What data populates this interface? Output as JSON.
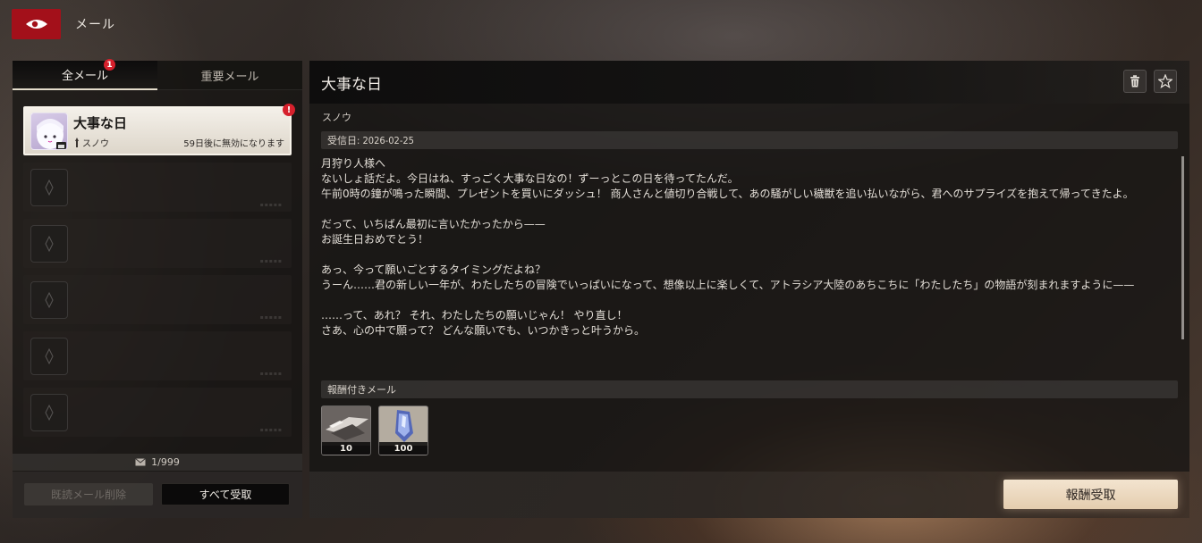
{
  "header": {
    "title": "メール",
    "back_icon": "back-eye-icon"
  },
  "tabs": [
    {
      "label": "全メール",
      "active": true,
      "badge": "1"
    },
    {
      "label": "重要メール",
      "active": false
    }
  ],
  "mail_list": {
    "selected": {
      "subject": "大事な日",
      "sender": "スノウ",
      "expiry": "59日後に無効になります",
      "alert": "!"
    },
    "empty_slots": 5
  },
  "mail_count": "1/999",
  "left_footer": {
    "delete_read_label": "既読メール削除",
    "receive_all_label": "すべて受取"
  },
  "detail": {
    "title": "大事な日",
    "sender": "スノウ",
    "received_date": "受信日: 2026-02-25",
    "body": "月狩り人様へ\nないしょ話だよ。今日はね、すっごく大事な日なの！ずーっとこの日を待ってたんだ。\n午前0時の鐘が鳴った瞬間、プレゼントを買いにダッシュ！ 商人さんと値切り合戦して、あの騒がしい穢獣を追い払いながら、君へのサプライズを抱えて帰ってきたよ。\n\nだって、いちばん最初に言いたかったから——\nお誕生日おめでとう！\n\nあっ、今って願いごとするタイミングだよね？\nうーん……君の新しい一年が、わたしたちの冒険でいっぱいになって、想像以上に楽しくて、アトラシア大陸のあちこちに「わたしたち」の物語が刻まれますように——\n\n……って、あれ？ それ、わたしたちの願いじゃん！ やり直し！\nさあ、心の中で願って？ どんな願いでも、いつかきっと叶うから。",
    "reward_section_label": "報酬付きメール",
    "rewards": [
      {
        "item": "weapon-material",
        "quantity": "10"
      },
      {
        "item": "crystal-shard",
        "quantity": "100"
      }
    ],
    "claim_label": "報酬受取"
  },
  "colors": {
    "accent_red": "#a3101a",
    "badge_red": "#d6202c",
    "claim_button": "#f3e4cf"
  }
}
